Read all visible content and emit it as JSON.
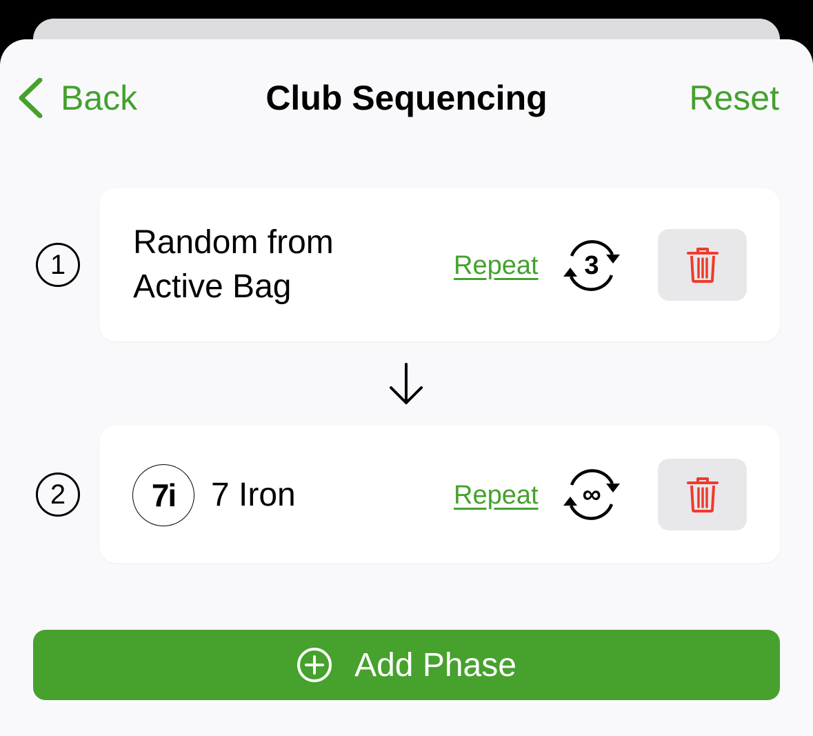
{
  "header": {
    "back_label": "Back",
    "title": "Club Sequencing",
    "reset_label": "Reset"
  },
  "phases": [
    {
      "number": "1",
      "title": "Random from Active Bag",
      "repeat_label": "Repeat",
      "repeat_count": "3",
      "repeat_icon": "repeat-count-icon",
      "delete_icon": "trash-icon"
    },
    {
      "number": "2",
      "club_badge": "7i",
      "title": "7 Iron",
      "repeat_label": "Repeat",
      "repeat_count": "∞",
      "repeat_icon": "repeat-infinite-icon",
      "delete_icon": "trash-icon"
    }
  ],
  "add_phase": {
    "label": "Add Phase",
    "icon": "plus-circle-icon"
  },
  "colors": {
    "accent": "#44a12e",
    "button": "#46a12d",
    "delete_icon": "#ee3b2d",
    "delete_bg": "#e8e8ea"
  }
}
